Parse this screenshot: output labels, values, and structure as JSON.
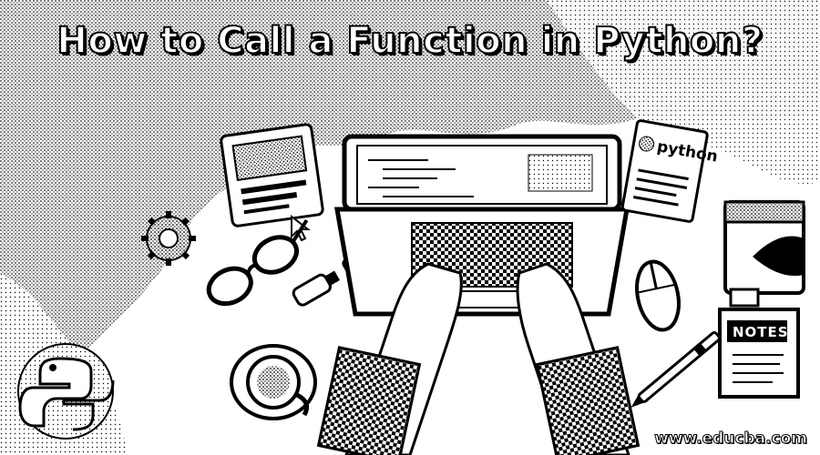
{
  "banner": {
    "title": "How to Call a Function in Python?",
    "website": "www.educba.com"
  },
  "illustration": {
    "book_label": "python",
    "notepad_label": "NOTES",
    "icons": [
      "monitor-icon",
      "gear-icon",
      "glasses-icon",
      "usb-drive-icon",
      "python-logo-icon",
      "coffee-cup-icon",
      "laptop-icon",
      "python-document-icon",
      "book-icon",
      "mouse-icon",
      "pen-icon",
      "notepad-icon"
    ]
  },
  "colors": {
    "ink": "#000000",
    "paper": "#ffffff"
  }
}
